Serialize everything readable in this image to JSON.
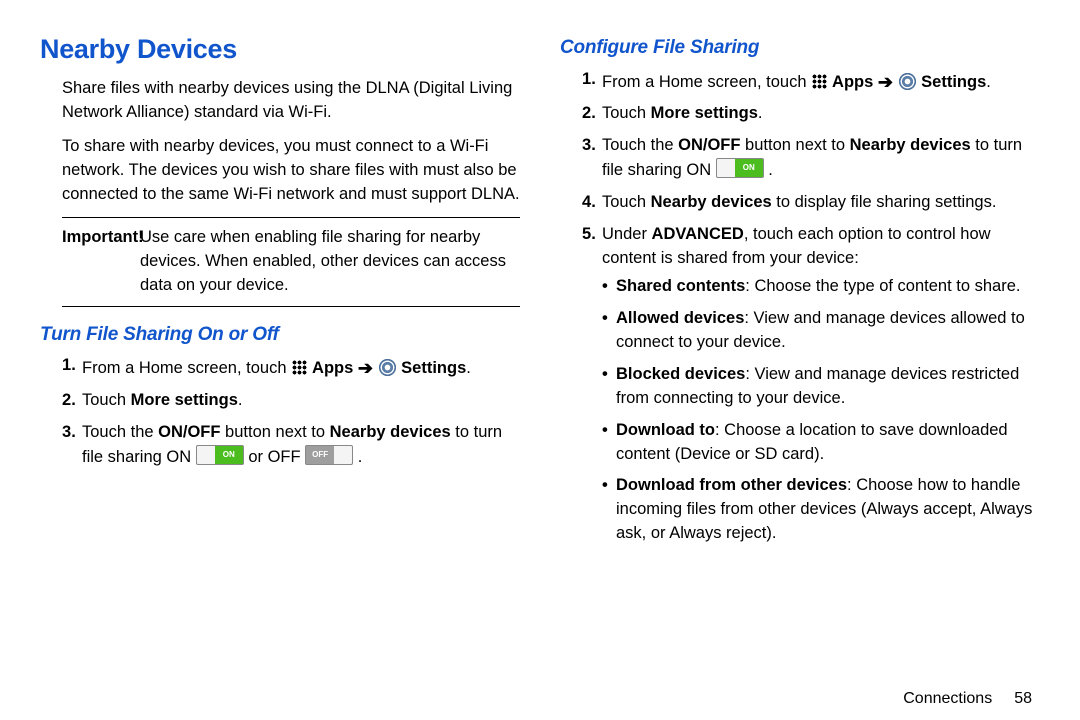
{
  "left": {
    "title": "Nearby Devices",
    "intro1": "Share files with nearby devices using the DLNA (Digital Living Network Alliance) standard via Wi-Fi.",
    "intro2": "To share with nearby devices, you must connect to a Wi-Fi network. The devices you wish to share files with must also be connected to the same Wi-Fi network and must support DLNA.",
    "important_label": "Important!",
    "important_body": "Use care when enabling file sharing for nearby devices. When enabled, other devices can access data on your device.",
    "sub1": "Turn File Sharing On or Off",
    "steps": {
      "s1a": "From a Home screen, touch ",
      "apps_label": " Apps ",
      "settings_label": " Settings",
      "s2a": "Touch ",
      "s2b": "More settings",
      "s3a": "Touch the ",
      "s3b": "ON/OFF",
      "s3c": " button next to ",
      "s3d": "Nearby devices",
      "s3e": " to turn file sharing ON ",
      "s3f": " or OFF ",
      "on_text": "ON",
      "off_text": "OFF"
    }
  },
  "right": {
    "sub1": "Configure File Sharing",
    "steps": {
      "s1a": "From a Home screen, touch ",
      "apps_label": " Apps ",
      "settings_label": " Settings",
      "s2a": "Touch ",
      "s2b": "More settings",
      "s3a": "Touch the ",
      "s3b": "ON/OFF",
      "s3c": " button next to ",
      "s3d": "Nearby devices",
      "s3e": " to turn file sharing ON ",
      "on_text": "ON",
      "s4a": "Touch ",
      "s4b": "Nearby devices",
      "s4c": " to display file sharing settings.",
      "s5a": "Under ",
      "s5b": "ADVANCED",
      "s5c": ", touch each option to control how content is shared from your device:",
      "b1a": "Shared contents",
      "b1b": ": Choose the type of content to share.",
      "b2a": "Allowed devices",
      "b2b": ": View and manage devices allowed to connect to your device.",
      "b3a": "Blocked devices",
      "b3b": ": View and manage devices restricted from connecting to your device.",
      "b4a": "Download to",
      "b4b": ": Choose a location to save downloaded content (Device or SD card).",
      "b5a": "Download from other devices",
      "b5b": ": Choose how to handle incoming files from other devices (Always accept, Always ask, or Always reject)."
    }
  },
  "footer": {
    "section": "Connections",
    "page": "58"
  }
}
